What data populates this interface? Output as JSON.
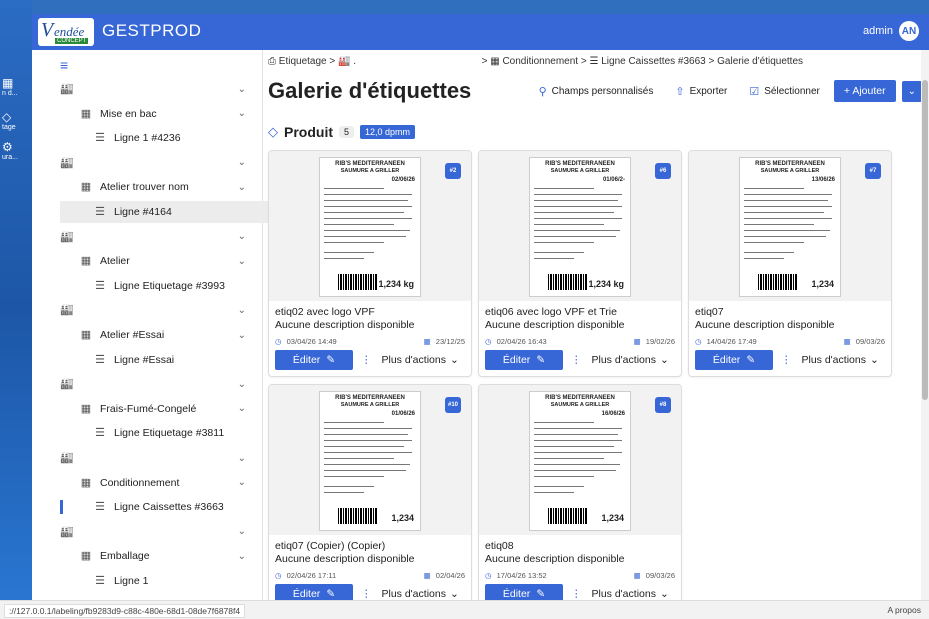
{
  "app": {
    "logo_initial": "V",
    "logo_text": "endée",
    "logo_sub": "CONCEPT",
    "title": "GESTPROD",
    "user": "admin",
    "user_initials": "AN"
  },
  "rail": [
    "n d...",
    "tage",
    "ura..."
  ],
  "sidebar": {
    "items": [
      {
        "type": "group",
        "label": ""
      },
      {
        "type": "sub",
        "label": "Mise en bac"
      },
      {
        "type": "line",
        "label": "Ligne 1 #4236"
      },
      {
        "type": "group",
        "label": ""
      },
      {
        "type": "sub",
        "label": "Atelier trouver nom"
      },
      {
        "type": "line",
        "label": "Ligne #4164"
      },
      {
        "type": "group",
        "label": ""
      },
      {
        "type": "sub",
        "label": "Atelier"
      },
      {
        "type": "line",
        "label": "Ligne Etiquetage #3993"
      },
      {
        "type": "group",
        "label": ""
      },
      {
        "type": "sub",
        "label": "Atelier #Essai"
      },
      {
        "type": "line",
        "label": "Ligne #Essai"
      },
      {
        "type": "group",
        "label": ""
      },
      {
        "type": "sub",
        "label": "Frais-Fumé-Congelé"
      },
      {
        "type": "line",
        "label": "Ligne Etiquetage #3811"
      },
      {
        "type": "group",
        "label": ""
      },
      {
        "type": "sub",
        "label": "Conditionnement"
      },
      {
        "type": "line",
        "label": "Ligne Caissettes #3663"
      },
      {
        "type": "group",
        "label": ""
      },
      {
        "type": "sub",
        "label": "Emballage"
      },
      {
        "type": "line",
        "label": "Ligne 1"
      }
    ]
  },
  "breadcrumb": {
    "etiquetage": "Etiquetage",
    "conditionnement": "Conditionnement",
    "ligne": "Ligne Caissettes #3663",
    "current": "Galerie d'étiquettes"
  },
  "page": {
    "title": "Galerie d'étiquettes",
    "custom_fields": "Champs personnalisés",
    "export": "Exporter",
    "select": "Sélectionner",
    "add": "Ajouter"
  },
  "section": {
    "name": "Produit",
    "count": "5",
    "dpm": "12,0 dpmm"
  },
  "label_art": {
    "line1": "RIB'S MEDITERRANEEN",
    "line2": "SAUMURE A GRILLER"
  },
  "cards": [
    {
      "badge": "#2",
      "lot": "02/06/26",
      "weight": "1,234 kg",
      "name": "etiq02 avec logo VPF",
      "desc": "Aucune description disponible",
      "created": "03/04/26 14:49",
      "expires": "23/12/25",
      "edit": "Éditer",
      "more": "Plus d'actions"
    },
    {
      "badge": "#6",
      "lot": "01/06/2-",
      "weight": "1,234 kg",
      "name": "etiq06 avec logo VPF et Trie",
      "desc": "Aucune description disponible",
      "created": "02/04/26 16:43",
      "expires": "19/02/26",
      "edit": "Éditer",
      "more": "Plus d'actions"
    },
    {
      "badge": "#7",
      "lot": "13/06/26",
      "weight": "1,234",
      "name": "etiq07",
      "desc": "Aucune description disponible",
      "created": "14/04/26 17:49",
      "expires": "09/03/26",
      "edit": "Éditer",
      "more": "Plus d'actions"
    },
    {
      "badge": "#10",
      "lot": "01/06/26",
      "weight": "1,234",
      "name": "etiq07 (Copier) (Copier)",
      "desc": "Aucune description disponible",
      "created": "02/04/26 17:11",
      "expires": "02/04/26",
      "edit": "Éditer",
      "more": "Plus d'actions"
    },
    {
      "badge": "#8",
      "lot": "16/06/26",
      "weight": "1,234",
      "name": "etiq08",
      "desc": "Aucune description disponible",
      "created": "17/04/26 13:52",
      "expires": "09/03/26",
      "edit": "Éditer",
      "more": "Plus d'actions"
    }
  ],
  "status": {
    "url": "://127.0.0.1/labeling/fb9283d9-c88c-480e-68d1-08de7f6878f4",
    "about": "A propos"
  }
}
